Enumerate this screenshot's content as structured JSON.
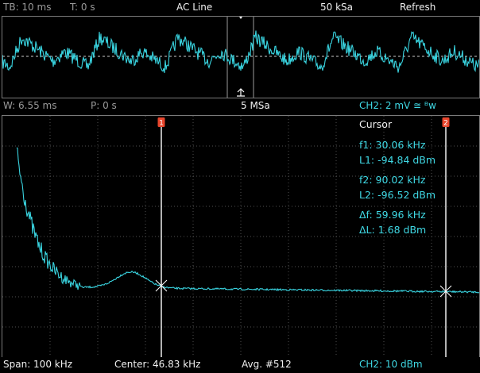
{
  "top_bar": {
    "tb": "TB: 10 ms",
    "t": "T: 0 s",
    "trigger_source": "AC Line",
    "sample_rate": "50 kSa",
    "mode": "Refresh"
  },
  "mid_bar": {
    "window": "W: 6.55 ms",
    "position": "P: 0 s",
    "sample_rate": "5 MSa",
    "channel": "CH2: 2 mV ≅ ᴮᴡ"
  },
  "cursor": {
    "title": "Cursor",
    "f1": "f1: 30.06 kHz",
    "l1": "L1: -94.84 dBm",
    "f2": "f2: 90.02 kHz",
    "l2": "L2: -96.52 dBm",
    "df": "Δf: 59.96 kHz",
    "dl": "ΔL: 1.68 dBm",
    "marker1": "1",
    "marker2": "2"
  },
  "bottom_bar": {
    "span": "Span: 100 kHz",
    "center": "Center: 46.83 kHz",
    "avg": "Avg. #512",
    "channel": "CH2: 10 dBm"
  },
  "colors": {
    "trace": "#39d3df",
    "grid": "#505050",
    "marker": "#e8452c",
    "cursor_line": "#ffffff"
  }
}
